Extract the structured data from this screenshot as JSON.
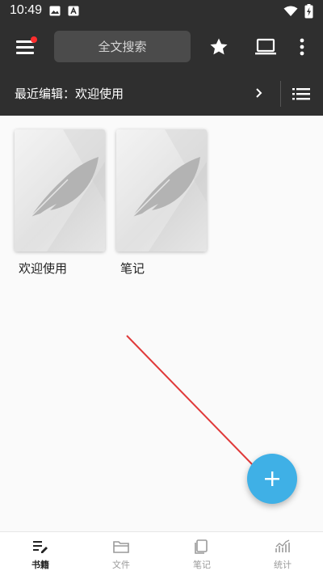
{
  "status_bar": {
    "time": "10:49",
    "icons": [
      "image-icon",
      "app-a-icon",
      "wifi-icon",
      "battery-icon"
    ]
  },
  "toolbar": {
    "search_placeholder": "全文搜索",
    "icons": [
      "menu-icon",
      "star-icon",
      "laptop-icon",
      "more-vert-icon"
    ],
    "notification_dot_color": "#ff2d2d"
  },
  "recent": {
    "label": "最近编辑：欢迎使用"
  },
  "books": [
    {
      "title": "欢迎使用",
      "cover_icon": "feather-icon"
    },
    {
      "title": "笔记",
      "cover_icon": "feather-icon"
    }
  ],
  "fab": {
    "icon": "plus-icon",
    "color": "#3fb0e6"
  },
  "bottom_nav": [
    {
      "label": "书籍",
      "icon": "book-edit-icon",
      "active": true
    },
    {
      "label": "文件",
      "icon": "folder-icon",
      "active": false
    },
    {
      "label": "笔记",
      "icon": "note-icon",
      "active": false
    },
    {
      "label": "统计",
      "icon": "chart-icon",
      "active": false
    }
  ],
  "colors": {
    "toolbar_bg": "#2f2f2f",
    "annotation_arrow": "#e03a3a"
  }
}
